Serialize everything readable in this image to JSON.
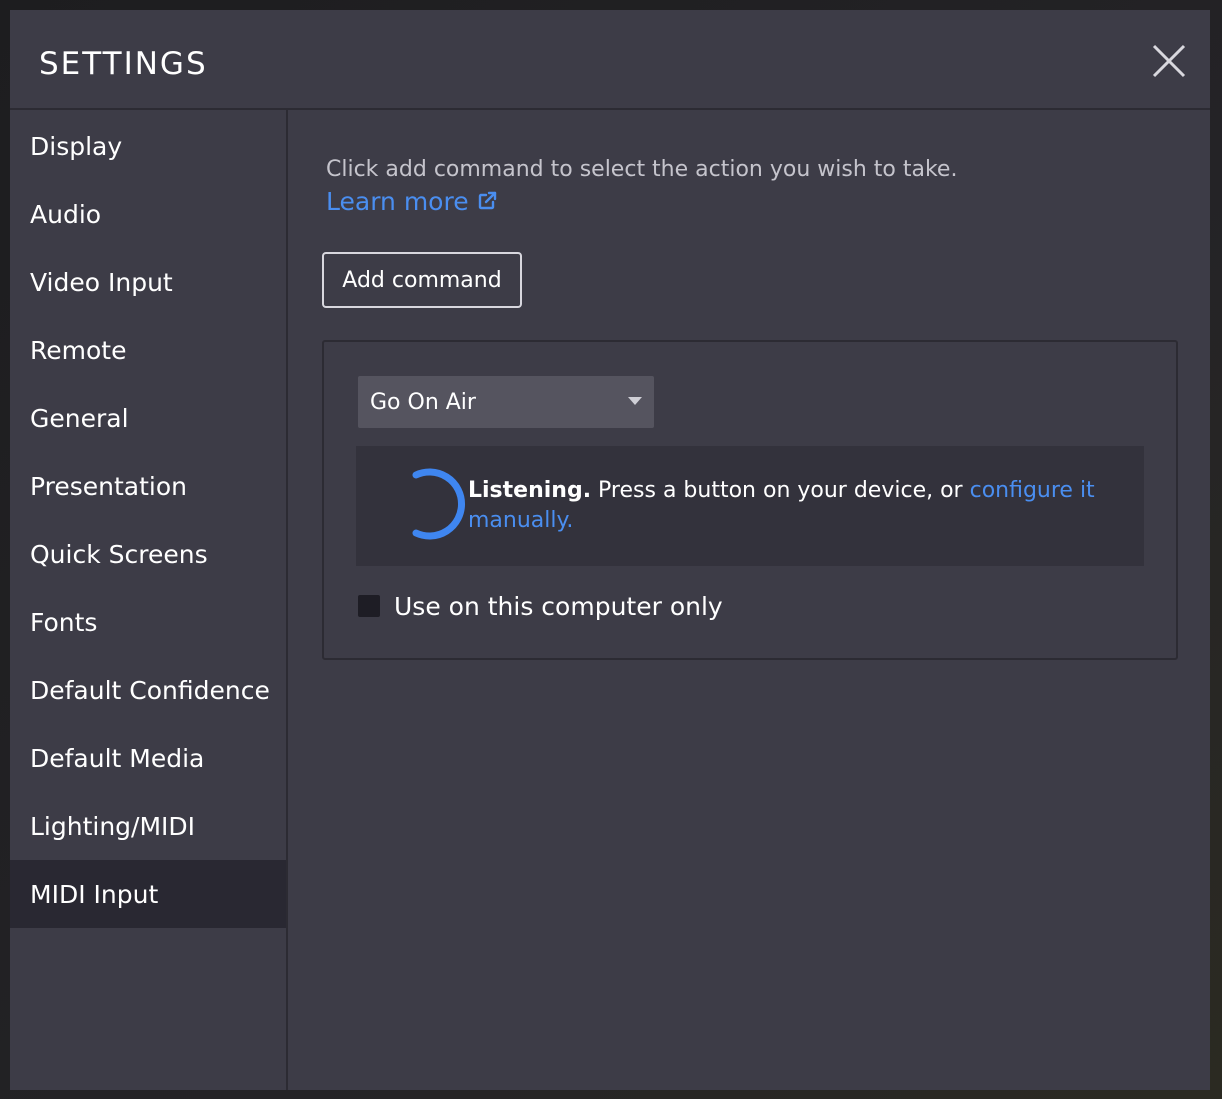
{
  "modal": {
    "title": "SETTINGS",
    "close_icon": "close-icon"
  },
  "sidebar": {
    "items": [
      {
        "label": "Display",
        "active": false
      },
      {
        "label": "Audio",
        "active": false
      },
      {
        "label": "Video Input",
        "active": false
      },
      {
        "label": "Remote",
        "active": false
      },
      {
        "label": "General",
        "active": false
      },
      {
        "label": "Presentation",
        "active": false
      },
      {
        "label": "Quick Screens",
        "active": false
      },
      {
        "label": "Fonts",
        "active": false
      },
      {
        "label": "Default Confidence",
        "active": false
      },
      {
        "label": "Default Media",
        "active": false
      },
      {
        "label": "Lighting/MIDI",
        "active": false
      },
      {
        "label": "MIDI Input",
        "active": true
      }
    ]
  },
  "content": {
    "intro_text": "Click add command to select the action you wish to take.",
    "learn_more_label": "Learn more",
    "learn_more_icon": "external-link-icon",
    "add_command_label": "Add command",
    "command": {
      "selected_action": "Go On Air",
      "listening_title": "Listening.",
      "listening_message": " Press a button on your device, or ",
      "configure_link": "configure it manually.",
      "local_only_label": "Use on this computer only",
      "local_only_checked": false
    }
  },
  "colors": {
    "background": "#3d3c47",
    "active_item": "#292832",
    "link": "#4a8ef0",
    "spinner": "#3f86f0"
  }
}
